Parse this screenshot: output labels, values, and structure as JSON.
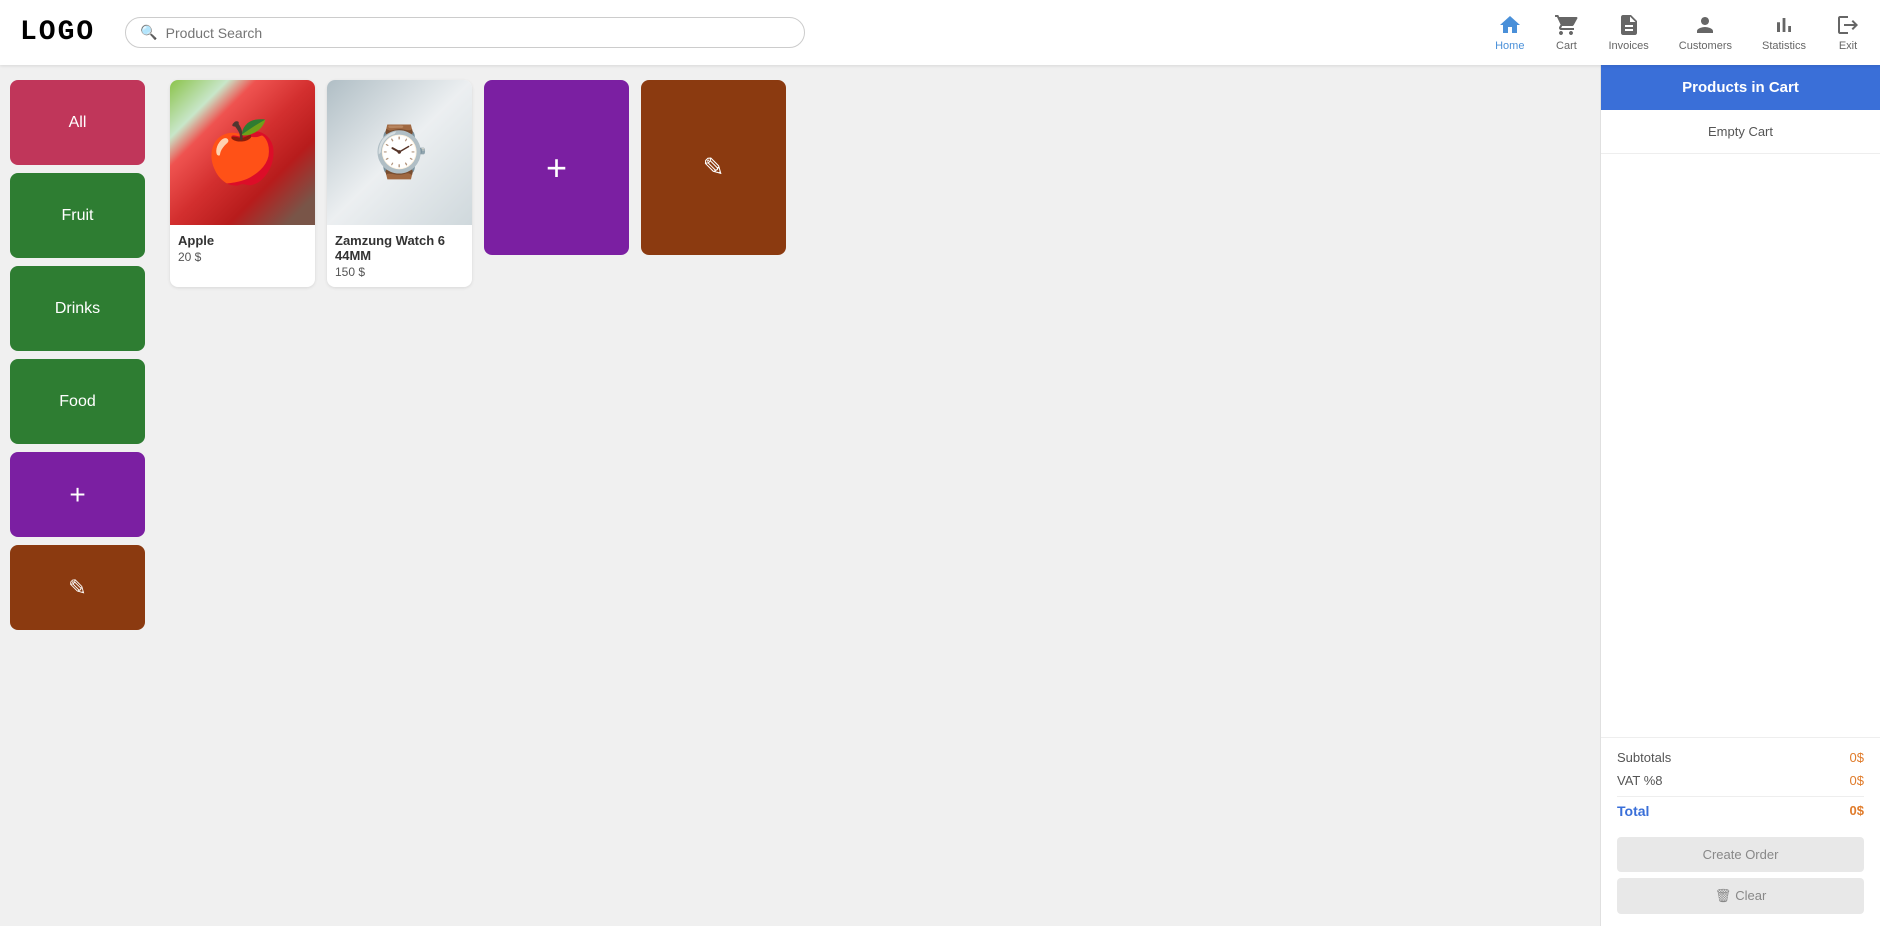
{
  "header": {
    "logo": "LOGO",
    "search_placeholder": "Product Search",
    "nav": [
      {
        "id": "home",
        "label": "Home",
        "icon": "home",
        "active": true
      },
      {
        "id": "cart",
        "label": "Cart",
        "icon": "cart",
        "active": false
      },
      {
        "id": "invoices",
        "label": "Invoices",
        "icon": "invoices",
        "active": false
      },
      {
        "id": "customers",
        "label": "Customers",
        "icon": "customers",
        "active": false
      },
      {
        "id": "statistics",
        "label": "Statistics",
        "icon": "statistics",
        "active": false
      },
      {
        "id": "exit",
        "label": "Exit",
        "icon": "exit",
        "active": false
      }
    ]
  },
  "sidebar": {
    "items": [
      {
        "id": "all",
        "label": "All",
        "color": "#c0365a"
      },
      {
        "id": "fruit",
        "label": "Fruit",
        "color": "#2e7d32"
      },
      {
        "id": "drinks",
        "label": "Drinks",
        "color": "#2e7d32"
      },
      {
        "id": "food",
        "label": "Food",
        "color": "#2e7d32"
      },
      {
        "id": "add-category",
        "label": "+",
        "color": "#7b1fa2"
      },
      {
        "id": "edit-category",
        "label": "✎",
        "color": "#8b3a10"
      }
    ]
  },
  "products": [
    {
      "id": "apple",
      "name": "Apple",
      "price": "20 $",
      "image_type": "apple"
    },
    {
      "id": "zamzung-watch",
      "name": "Zamzung Watch 6 44MM",
      "price": "150 $",
      "image_type": "watch"
    },
    {
      "id": "add-product",
      "type": "add",
      "color": "#7b1fa2",
      "label": "+"
    },
    {
      "id": "edit-product",
      "type": "edit",
      "color": "#8b3a10",
      "label": "✎"
    }
  ],
  "cart": {
    "header": "Products in Cart",
    "empty_label": "Empty Cart",
    "subtotals_label": "Subtotals",
    "subtotals_value": "0$",
    "vat_label": "VAT %8",
    "vat_value": "0$",
    "total_label": "Total",
    "total_value": "0$",
    "create_order_label": "Create Order",
    "clear_label": "Clear"
  }
}
